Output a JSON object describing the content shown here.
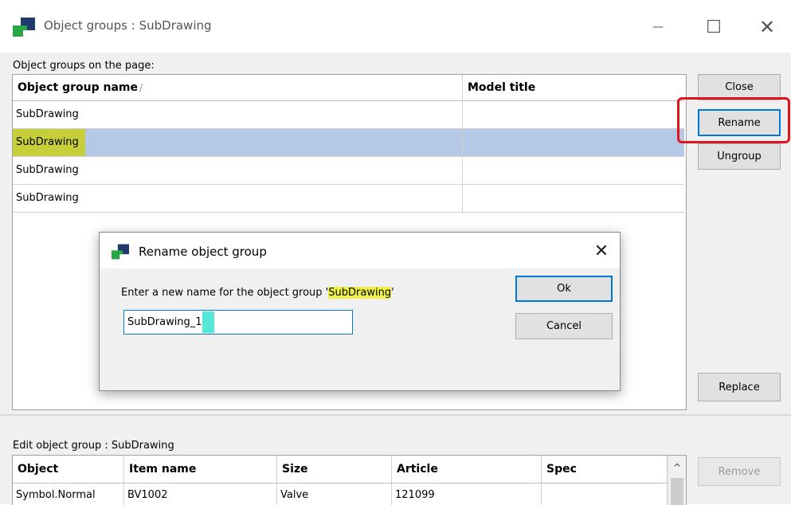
{
  "window": {
    "title": "Object groups : SubDrawing",
    "minimize_glyph": "—",
    "maximize_glyph": "☐",
    "close_glyph": "✕"
  },
  "groups_section": {
    "label": "Object groups on the page:",
    "columns": {
      "name": "Object group name",
      "sort_indicator": "/",
      "model": "Model title"
    },
    "rows": [
      {
        "name": "SubDrawing",
        "model": ""
      },
      {
        "name": "SubDrawing",
        "model": ""
      },
      {
        "name": "SubDrawing",
        "model": ""
      },
      {
        "name": "SubDrawing",
        "model": ""
      }
    ],
    "selected_row": 1
  },
  "side_buttons": {
    "close": "Close",
    "rename": "Rename",
    "ungroup": "Ungroup",
    "replace": "Replace",
    "remove": "Remove"
  },
  "edit_section": {
    "label": "Edit object group : SubDrawing",
    "columns": [
      "Object",
      "Item name",
      "Size",
      "Article",
      "Spec"
    ],
    "rows": [
      [
        "Symbol.Normal",
        "BV1002",
        "Valve",
        "121099",
        ""
      ]
    ],
    "scroll_up_glyph": "^"
  },
  "dialog": {
    "title": "Rename object group",
    "close_glyph": "✕",
    "prompt_prefix": "Enter a new name for the object group '",
    "prompt_name": "SubDrawing",
    "prompt_suffix": "'",
    "input_value": "SubDrawing_1",
    "ok": "Ok",
    "cancel": "Cancel"
  },
  "icons": {
    "app": "app-logo-icon",
    "dialog": "app-logo-icon"
  },
  "colors": {
    "selection": "#b5c9e6",
    "highlight_yellow": "#c6cf3a",
    "prompt_highlight": "#eef04a",
    "caret_highlight": "#55e8d8",
    "annotation_red": "#e0141f",
    "focus_blue": "#0078d7"
  }
}
